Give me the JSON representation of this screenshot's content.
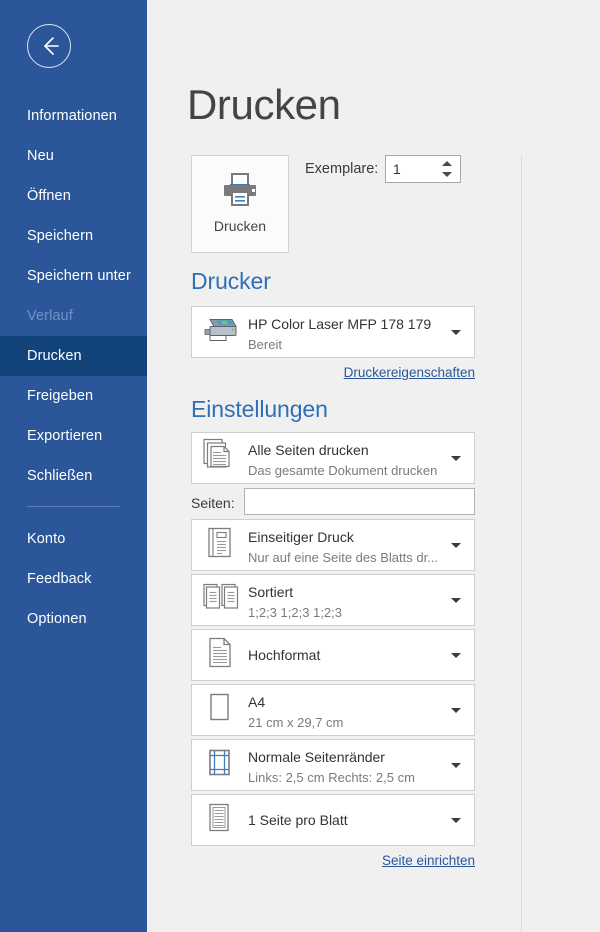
{
  "sidebar": {
    "back_icon": "back-arrow-icon",
    "items": [
      {
        "label": "Informationen",
        "state": "normal"
      },
      {
        "label": "Neu",
        "state": "normal"
      },
      {
        "label": "Öffnen",
        "state": "normal"
      },
      {
        "label": "Speichern",
        "state": "normal"
      },
      {
        "label": "Speichern unter",
        "state": "normal"
      },
      {
        "label": "Verlauf",
        "state": "disabled"
      },
      {
        "label": "Drucken",
        "state": "active"
      },
      {
        "label": "Freigeben",
        "state": "normal"
      },
      {
        "label": "Exportieren",
        "state": "normal"
      },
      {
        "label": "Schließen",
        "state": "normal"
      }
    ],
    "items_bottom": [
      {
        "label": "Konto",
        "state": "normal"
      },
      {
        "label": "Feedback",
        "state": "normal"
      },
      {
        "label": "Optionen",
        "state": "normal"
      }
    ],
    "background_color": "#2b579a",
    "active_color": "#12427a",
    "disabled_color": "#6f93c4"
  },
  "main": {
    "title": "Drucken",
    "print_button": {
      "label": "Drucken",
      "icon": "printer-icon"
    },
    "copies": {
      "label": "Exemplare:",
      "value": "1"
    },
    "printer_section": {
      "heading": "Drucker",
      "info_icon": "info-icon",
      "selected": {
        "name": "HP Color Laser MFP 178 179",
        "status": "Bereit",
        "icon": "printer-device-icon"
      },
      "properties_link": "Druckereigenschaften"
    },
    "settings_section": {
      "heading": "Einstellungen",
      "pages_row": {
        "label": "Seiten:",
        "value": "",
        "placeholder": "",
        "info_icon": "info-icon"
      },
      "page_setup_link": "Seite einrichten",
      "options": [
        {
          "id": "print-range",
          "icon": "all-pages-icon",
          "title": "Alle Seiten drucken",
          "subtitle": "Das gesamte Dokument drucken"
        },
        {
          "id": "sides",
          "icon": "one-sided-icon",
          "title": "Einseitiger Druck",
          "subtitle": "Nur auf eine Seite des Blatts dr..."
        },
        {
          "id": "collation",
          "icon": "collated-icon",
          "title": "Sortiert",
          "subtitle": "1;2;3    1;2;3    1;2;3"
        },
        {
          "id": "orientation",
          "icon": "portrait-icon",
          "title": "Hochformat",
          "subtitle": ""
        },
        {
          "id": "paper-size",
          "icon": "paper-icon",
          "title": "A4",
          "subtitle": "21 cm x 29,7 cm"
        },
        {
          "id": "margins",
          "icon": "margins-icon",
          "title": "Normale Seitenränder",
          "subtitle": "Links: 2,5 cm    Rechts: 2,5 cm"
        },
        {
          "id": "pages-per-sheet",
          "icon": "pages-per-sheet-icon",
          "title": "1 Seite pro Blatt",
          "subtitle": ""
        }
      ]
    }
  },
  "colors": {
    "accent": "#2b579a",
    "heading": "#2e6fb7",
    "link": "#2b579a",
    "background": "#f0f0f0"
  }
}
